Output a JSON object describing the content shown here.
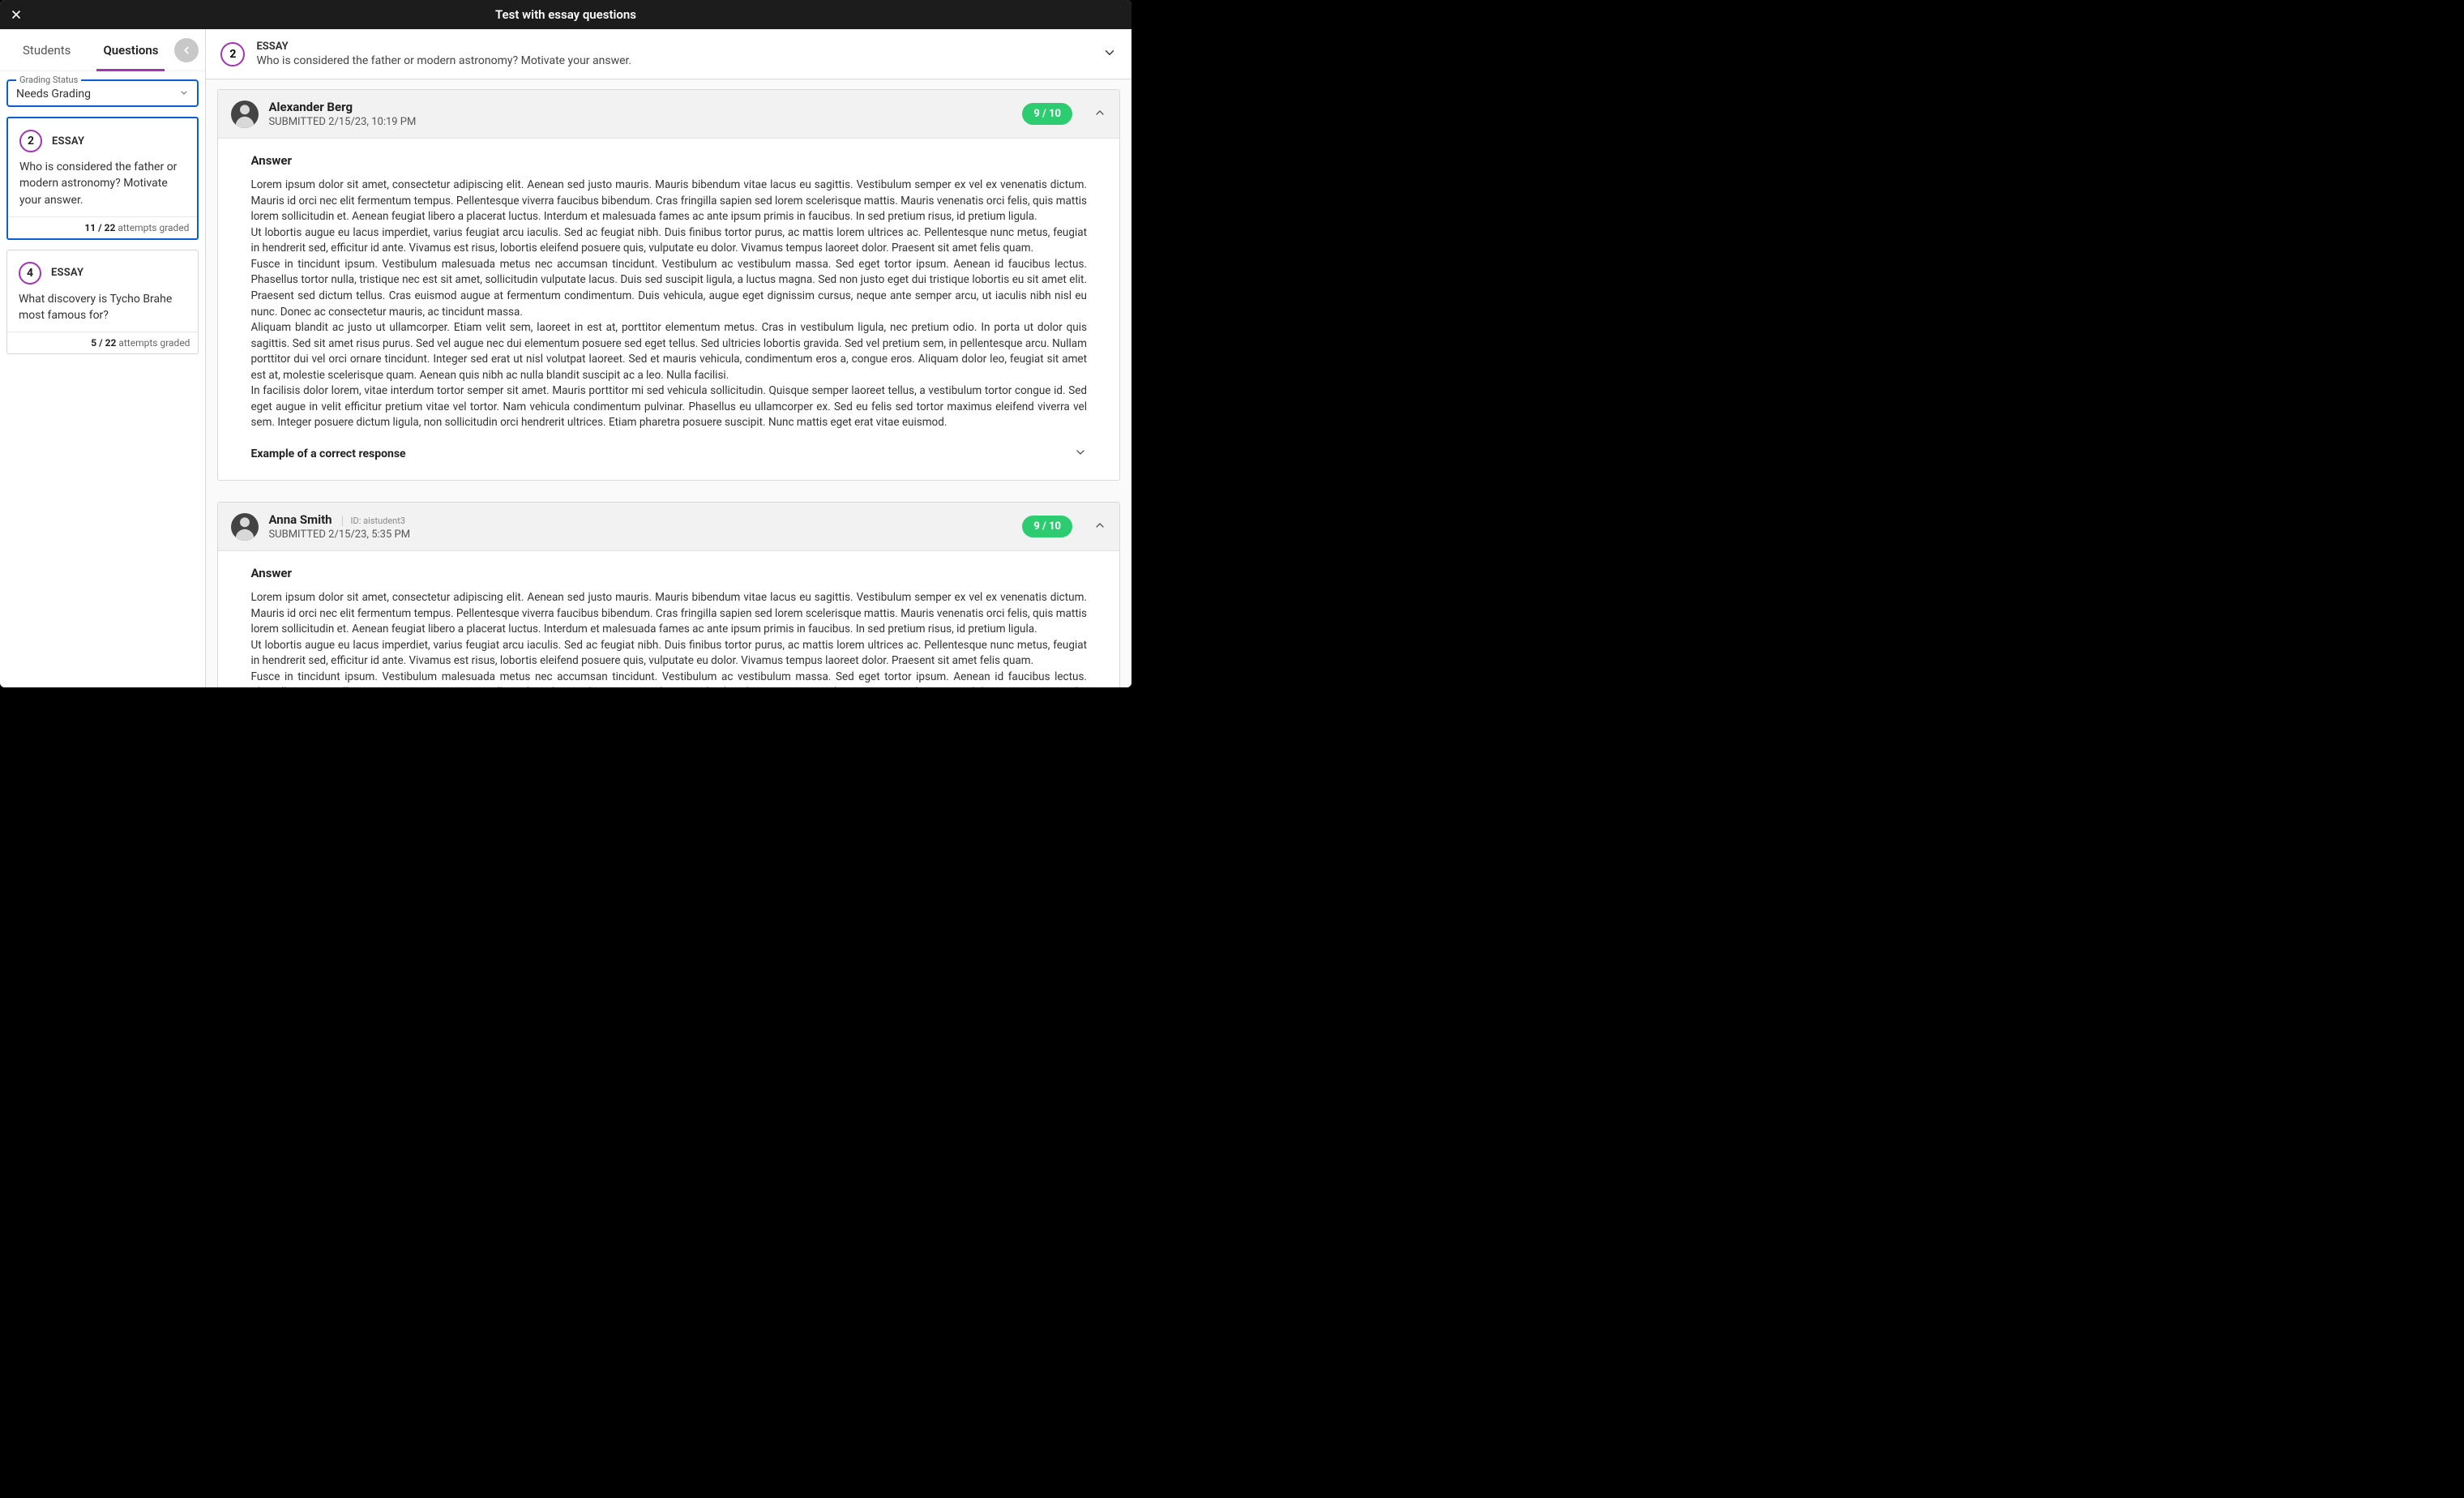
{
  "titlebar": {
    "title": "Test with essay questions"
  },
  "tabs": {
    "students": "Students",
    "questions": "Questions"
  },
  "filter": {
    "legend": "Grading Status",
    "value": "Needs Grading"
  },
  "sidebar_questions": [
    {
      "number": "2",
      "type": "ESSAY",
      "text": "Who is considered the father or modern astronomy? Motivate your answer.",
      "graded_count": "11 / 22",
      "graded_suffix": "attempts graded",
      "selected": true
    },
    {
      "number": "4",
      "type": "ESSAY",
      "text": "What discovery is Tycho Brahe most famous for?",
      "graded_count": "5 / 22",
      "graded_suffix": "attempts graded",
      "selected": false
    }
  ],
  "current_question": {
    "number": "2",
    "type": "ESSAY",
    "text": "Who is considered the father or modern astronomy? Motivate your answer."
  },
  "submissions": [
    {
      "name": "Alexander Berg",
      "id_label": "",
      "submitted": "SUBMITTED 2/15/23, 10:19 PM",
      "score": "9 / 10",
      "answer_label": "Answer",
      "answer_body": "Lorem ipsum dolor sit amet, consectetur adipiscing elit. Aenean sed justo mauris. Mauris bibendum vitae lacus eu sagittis. Vestibulum semper ex vel ex venenatis dictum. Mauris id orci nec elit fermentum tempus. Pellentesque viverra faucibus bibendum. Cras fringilla sapien sed lorem scelerisque mattis. Mauris venenatis orci felis, quis mattis lorem sollicitudin et. Aenean feugiat libero a placerat luctus. Interdum et malesuada fames ac ante ipsum primis in faucibus. In sed pretium risus, id pretium ligula.\nUt lobortis augue eu lacus imperdiet, varius feugiat arcu iaculis. Sed ac feugiat nibh. Duis finibus tortor purus, ac mattis lorem ultrices ac. Pellentesque nunc metus, feugiat in hendrerit sed, efficitur id ante. Vivamus est risus, lobortis eleifend posuere quis, vulputate eu dolor. Vivamus tempus laoreet dolor. Praesent sit amet felis quam.\nFusce in tincidunt ipsum. Vestibulum malesuada metus nec accumsan tincidunt. Vestibulum ac vestibulum massa. Sed eget tortor ipsum. Aenean id faucibus lectus. Phasellus tortor nulla, tristique nec est sit amet, sollicitudin vulputate lacus. Duis sed suscipit ligula, a luctus magna. Sed non justo eget dui tristique lobortis eu sit amet elit. Praesent sed dictum tellus. Cras euismod augue at fermentum condimentum. Duis vehicula, augue eget dignissim cursus, neque ante semper arcu, ut iaculis nibh nisl eu nunc. Donec ac consectetur mauris, ac tincidunt massa.\nAliquam blandit ac justo ut ullamcorper. Etiam velit sem, laoreet in est at, porttitor elementum metus. Cras in vestibulum ligula, nec pretium odio. In porta ut dolor quis sagittis. Sed sit amet risus purus. Sed vel augue nec dui elementum posuere sed eget tellus. Sed ultricies lobortis gravida. Sed vel pretium sem, in pellentesque arcu. Nullam porttitor dui vel orci ornare tincidunt. Integer sed erat ut nisl volutpat laoreet. Sed et mauris vehicula, condimentum eros a, congue eros. Aliquam dolor leo, feugiat sit amet est at, molestie scelerisque quam. Aenean quis nibh ac nulla blandit suscipit ac a leo. Nulla facilisi.\nIn facilisis dolor lorem, vitae interdum tortor semper sit amet. Mauris porttitor mi sed vehicula sollicitudin. Quisque semper laoreet tellus, a vestibulum tortor congue id. Sed eget augue in velit efficitur pretium vitae vel tortor. Nam vehicula condimentum pulvinar. Phasellus eu ullamcorper ex. Sed eu felis sed tortor maximus eleifend viverra vel sem. Integer posuere dictum ligula, non sollicitudin orci hendrerit ultrices. Etiam pharetra posuere suscipit. Nunc mattis eget erat vitae euismod.",
      "example_label": "Example of a correct response",
      "show_example_toggle": true
    },
    {
      "name": "Anna Smith",
      "id_label": "ID: aistudent3",
      "submitted": "SUBMITTED 2/15/23, 5:35 PM",
      "score": "9 / 10",
      "answer_label": "Answer",
      "answer_body": "Lorem ipsum dolor sit amet, consectetur adipiscing elit. Aenean sed justo mauris. Mauris bibendum vitae lacus eu sagittis. Vestibulum semper ex vel ex venenatis dictum. Mauris id orci nec elit fermentum tempus. Pellentesque viverra faucibus bibendum. Cras fringilla sapien sed lorem scelerisque mattis. Mauris venenatis orci felis, quis mattis lorem sollicitudin et. Aenean feugiat libero a placerat luctus. Interdum et malesuada fames ac ante ipsum primis in faucibus. In sed pretium risus, id pretium ligula.\nUt lobortis augue eu lacus imperdiet, varius feugiat arcu iaculis. Sed ac feugiat nibh. Duis finibus tortor purus, ac mattis lorem ultrices ac. Pellentesque nunc metus, feugiat in hendrerit sed, efficitur id ante. Vivamus est risus, lobortis eleifend posuere quis, vulputate eu dolor. Vivamus tempus laoreet dolor. Praesent sit amet felis quam.\nFusce in tincidunt ipsum. Vestibulum malesuada metus nec accumsan tincidunt. Vestibulum ac vestibulum massa. Sed eget tortor ipsum. Aenean id faucibus lectus. Phasellus tortor nulla, tristique nec est sit amet, sollicitudin vulputate lacus. Duis sed suscipit ligula, a luctus magna. Sed non justo eget dui tristique lobortis eu sit amet elit. Praesent sed dictum tellus. Cras euismod augue at fermentum condimentum. Duis vehicula, augue eget dignissim cursus, neque ante semper arcu, ut iaculis nibh nisl eu nunc. Donec ac consectetur mauris, ac tincidunt massa.",
      "example_label": "",
      "show_example_toggle": false
    }
  ]
}
